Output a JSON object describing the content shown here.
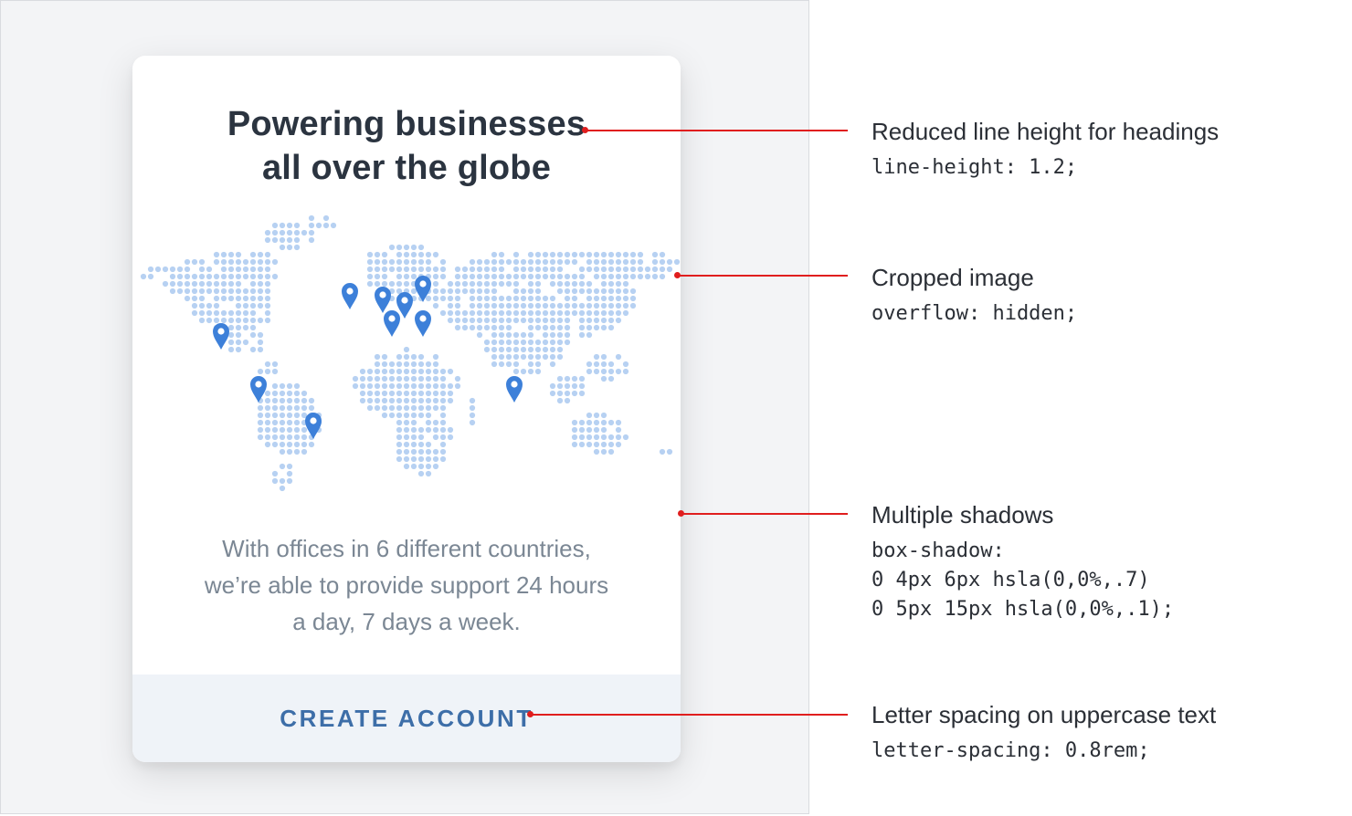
{
  "card": {
    "title_line1": "Powering businesses",
    "title_line2": "all over the globe",
    "body_line1": "With offices in 6 different countries,",
    "body_line2": "we’re able to provide support 24 hours",
    "body_line3": "a day, 7 days a week.",
    "button_label": "CREATE ACCOUNT"
  },
  "map": {
    "image": "world-dot-map",
    "dot_color": "#b7d1f2",
    "pin_color": "#3d80d9",
    "pin_icon": "map-pin-icon",
    "pin_count": 10
  },
  "annotations": [
    {
      "title": "Reduced line height for headings",
      "code": [
        "line-height: 1.2;"
      ]
    },
    {
      "title": "Cropped image",
      "code": [
        "overflow: hidden;"
      ]
    },
    {
      "title": "Multiple shadows",
      "code": [
        "box-shadow:",
        "0 4px 6px hsla(0,0%,.7)",
        "0 5px 15px hsla(0,0%,.1);"
      ]
    },
    {
      "title": "Letter spacing on uppercase text",
      "code": [
        "letter-spacing: 0.8rem;"
      ]
    }
  ],
  "colors": {
    "leader_line": "#e01e1e",
    "heading": "#2b3440",
    "body_text": "#7b8794",
    "button_text": "#3d6ea8",
    "footer_bg": "#eff3f8",
    "stage_bg": "#f3f4f6"
  }
}
